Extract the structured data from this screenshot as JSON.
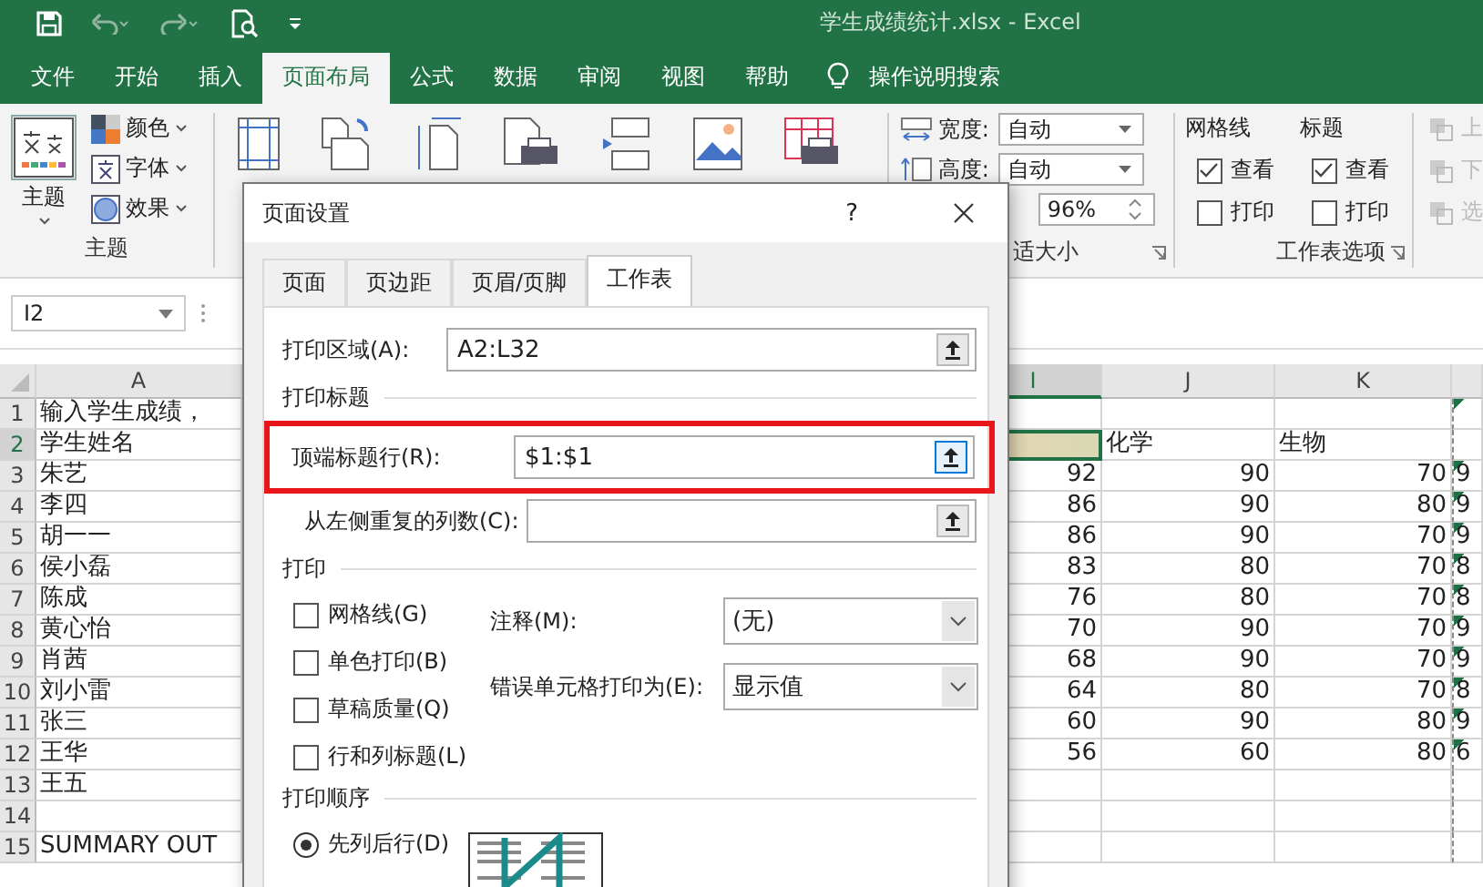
{
  "window": {
    "title": "学生成绩统计.xlsx  -  Excel"
  },
  "ribbon_tabs": [
    {
      "label": "文件",
      "selected": false
    },
    {
      "label": "开始",
      "selected": false
    },
    {
      "label": "插入",
      "selected": false
    },
    {
      "label": "页面布局",
      "selected": true
    },
    {
      "label": "公式",
      "selected": false
    },
    {
      "label": "数据",
      "selected": false
    },
    {
      "label": "审阅",
      "selected": false
    },
    {
      "label": "视图",
      "selected": false
    },
    {
      "label": "帮助",
      "selected": false
    }
  ],
  "search_hint": "操作说明搜索",
  "theme_group": {
    "button": "主题",
    "items": [
      "颜色",
      "字体",
      "效果"
    ],
    "label": "主题"
  },
  "scale_group": {
    "width_label": "宽度:",
    "width_value": "自动",
    "height_label": "高度:",
    "height_value": "自动",
    "scale_value": "96%",
    "label": "适大小"
  },
  "sheet_options": {
    "columns": [
      {
        "title": "网格线",
        "options": [
          {
            "label": "查看",
            "checked": true
          },
          {
            "label": "打印",
            "checked": false
          }
        ]
      },
      {
        "title": "标题",
        "options": [
          {
            "label": "查看",
            "checked": true
          },
          {
            "label": "打印",
            "checked": false
          }
        ]
      }
    ],
    "label": "工作表选项"
  },
  "arrange_items": [
    "上",
    "下",
    "选"
  ],
  "name_box": "I2",
  "sheet": {
    "columns": [
      {
        "label": "A",
        "selected": false
      },
      {
        "label": "I",
        "selected": true
      },
      {
        "label": "J",
        "selected": false
      },
      {
        "label": "K",
        "selected": false
      },
      {
        "selected": false
      }
    ],
    "rows": [
      {
        "num": "1",
        "kind": "data",
        "selected": false,
        "flagged": true,
        "cells": [
          "输入学生成绩，",
          null,
          null,
          null,
          null
        ]
      },
      {
        "num": "2",
        "kind": "labels",
        "selected": true,
        "flagged": false,
        "cells": [
          "学生姓名",
          null,
          "化学",
          "生物",
          null
        ]
      },
      {
        "num": "3",
        "kind": "data",
        "selected": false,
        "flagged": true,
        "cells": [
          "朱艺",
          "92",
          "90",
          "70",
          "9"
        ]
      },
      {
        "num": "4",
        "kind": "data",
        "selected": false,
        "flagged": true,
        "cells": [
          "李四",
          "86",
          "90",
          "80",
          "9"
        ]
      },
      {
        "num": "5",
        "kind": "data",
        "selected": false,
        "flagged": true,
        "cells": [
          "胡一一",
          "86",
          "90",
          "70",
          "9"
        ]
      },
      {
        "num": "6",
        "kind": "data",
        "selected": false,
        "flagged": true,
        "cells": [
          "侯小磊",
          "83",
          "80",
          "70",
          "8"
        ]
      },
      {
        "num": "7",
        "kind": "data",
        "selected": false,
        "flagged": true,
        "cells": [
          "陈成",
          "76",
          "80",
          "70",
          "8"
        ]
      },
      {
        "num": "8",
        "kind": "data",
        "selected": false,
        "flagged": true,
        "cells": [
          "黄心怡",
          "70",
          "90",
          "70",
          "9"
        ]
      },
      {
        "num": "9",
        "kind": "data",
        "selected": false,
        "flagged": true,
        "cells": [
          "肖茜",
          "68",
          "90",
          "70",
          "9"
        ]
      },
      {
        "num": "10",
        "kind": "data",
        "selected": false,
        "flagged": true,
        "cells": [
          "刘小雷",
          "64",
          "80",
          "70",
          "8"
        ]
      },
      {
        "num": "11",
        "kind": "data",
        "selected": false,
        "flagged": true,
        "cells": [
          "张三",
          "60",
          "90",
          "80",
          "9"
        ]
      },
      {
        "num": "12",
        "kind": "data",
        "selected": false,
        "flagged": true,
        "cells": [
          "王华",
          "56",
          "60",
          "80",
          "6"
        ]
      },
      {
        "num": "13",
        "kind": "data",
        "selected": false,
        "flagged": false,
        "cells": [
          "王五",
          null,
          null,
          null,
          null
        ]
      },
      {
        "num": "14",
        "kind": "data",
        "selected": false,
        "flagged": false,
        "cells": [
          null,
          null,
          null,
          null,
          null
        ]
      },
      {
        "num": "15",
        "kind": "data",
        "selected": false,
        "flagged": false,
        "cells": [
          "SUMMARY OUT",
          null,
          null,
          null,
          null
        ]
      }
    ]
  },
  "dialog": {
    "title": "页面设置",
    "help": "?",
    "tabs": [
      {
        "label": "页面",
        "selected": false
      },
      {
        "label": "页边距",
        "selected": false
      },
      {
        "label": "页眉/页脚",
        "selected": false
      },
      {
        "label": "工作表",
        "selected": true
      }
    ],
    "print_area": {
      "label": "打印区域(A):",
      "value": "A2:L32"
    },
    "titles_heading": "打印标题",
    "rows_to_repeat": {
      "label": "顶端标题行(R):",
      "value": "$1:$1",
      "highlighted": true
    },
    "cols_to_repeat": {
      "label": "从左侧重复的列数(C):"
    },
    "print_heading": "打印",
    "print_options": [
      {
        "label": "网格线(G)",
        "checked": false
      },
      {
        "label": "单色打印(B)",
        "checked": false
      },
      {
        "label": "草稿质量(Q)",
        "checked": false
      },
      {
        "label": "行和列标题(L)",
        "checked": false
      }
    ],
    "comments": {
      "label": "注释(M):",
      "value": "(无)"
    },
    "errors": {
      "label": "错误单元格打印为(E):",
      "value": "显示值"
    },
    "order_heading": "打印顺序",
    "order_options": [
      {
        "label": "先列后行(D)",
        "selected": true
      }
    ]
  }
}
